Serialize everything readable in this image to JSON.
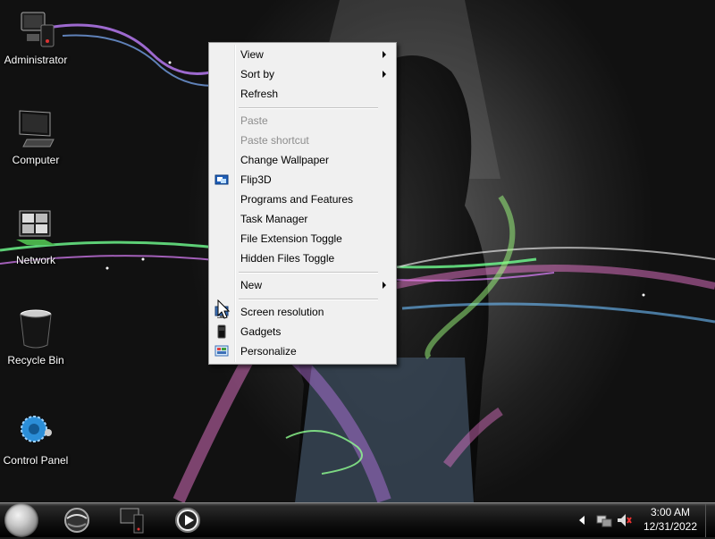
{
  "desktop": {
    "icons": [
      {
        "label": "Administrator",
        "icon": "user-folder-icon"
      },
      {
        "label": "Computer",
        "icon": "computer-icon"
      },
      {
        "label": "Network",
        "icon": "network-icon"
      },
      {
        "label": "Recycle Bin",
        "icon": "recycle-bin-icon"
      },
      {
        "label": "Control Panel",
        "icon": "control-panel-icon"
      }
    ]
  },
  "context_menu": {
    "items": [
      {
        "label": "View",
        "submenu": true,
        "enabled": true
      },
      {
        "label": "Sort by",
        "submenu": true,
        "enabled": true
      },
      {
        "label": "Refresh",
        "enabled": true
      },
      {
        "label": "Paste",
        "enabled": false
      },
      {
        "label": "Paste shortcut",
        "enabled": false
      },
      {
        "label": "Change Wallpaper",
        "enabled": true
      },
      {
        "label": "Flip3D",
        "enabled": true,
        "icon": "flip3d-icon"
      },
      {
        "label": "Programs and Features",
        "enabled": true
      },
      {
        "label": "Task Manager",
        "enabled": true
      },
      {
        "label": "File Extension Toggle",
        "enabled": true
      },
      {
        "label": "Hidden Files Toggle",
        "enabled": true
      },
      {
        "label": "New",
        "submenu": true,
        "enabled": true
      },
      {
        "label": "Screen resolution",
        "enabled": true,
        "icon": "screen-resolution-icon"
      },
      {
        "label": "Gadgets",
        "enabled": true,
        "icon": "gadgets-icon"
      },
      {
        "label": "Personalize",
        "enabled": true,
        "icon": "personalize-icon"
      }
    ]
  },
  "taskbar": {
    "pinned": [
      {
        "icon": "browser-globe-icon"
      },
      {
        "icon": "computer-explorer-icon"
      },
      {
        "icon": "media-player-icon"
      }
    ],
    "tray": [
      {
        "icon": "show-hidden-icons-arrow-icon"
      },
      {
        "icon": "network-tray-icon"
      },
      {
        "icon": "volume-tray-icon"
      }
    ],
    "clock": {
      "time": "3:00 AM",
      "date": "12/31/2022"
    }
  },
  "colors": {
    "menu_bg": "#f0f0f0",
    "menu_disabled_text": "#8d8d8d",
    "taskbar_bg": "#111111"
  }
}
